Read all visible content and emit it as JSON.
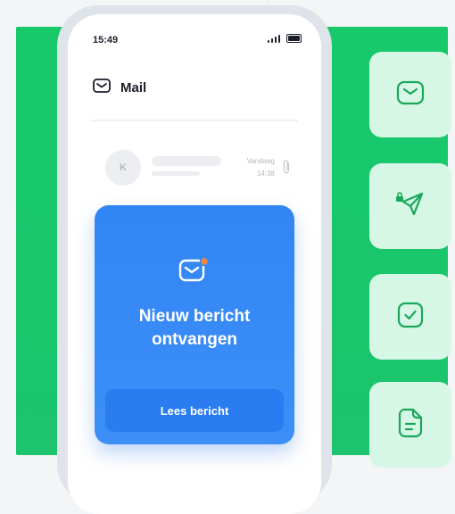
{
  "status_bar": {
    "time": "15:49"
  },
  "mail_app": {
    "title": "Mail"
  },
  "message_preview": {
    "avatar_initial": "K",
    "date_label": "Vandaag",
    "time_label": "14:38"
  },
  "notification": {
    "title": "Nieuw bericht ontvangen",
    "button_label": "Lees bericht"
  },
  "side_icons": [
    "mail-icon",
    "secure-send-icon",
    "checked-icon",
    "document-icon"
  ],
  "colors": {
    "green_background": "#1bc46d",
    "notification_blue": "#3285f4",
    "side_card": "#d6f7e5",
    "icon_green": "#19a85a",
    "badge_orange": "#f0883e"
  }
}
